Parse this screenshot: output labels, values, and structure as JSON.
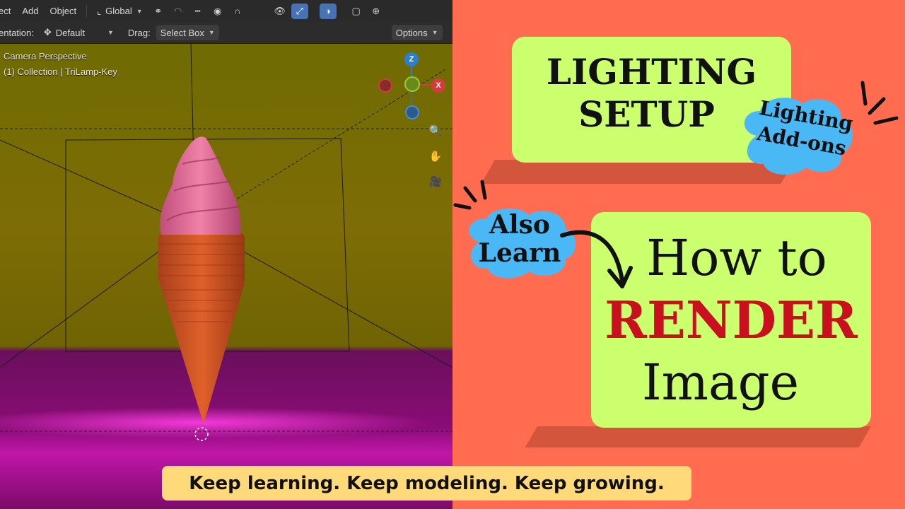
{
  "toolbar": {
    "menu_select_partial": "ect",
    "menu_add": "Add",
    "menu_object": "Object",
    "transform_orientation": "Global",
    "icons": [
      "transform-axes-icon",
      "link-icon",
      "magnet-icon",
      "snap-increment-icon",
      "proportional-edit-icon",
      "falloff-icon",
      "visibility-icon",
      "gizmo-icon",
      "overlay-icon",
      "xray-icon",
      "shading-wire-icon"
    ]
  },
  "header2": {
    "orientation_label": "entation:",
    "orientation_value": "Default",
    "drag_label": "Drag:",
    "drag_value": "Select Box",
    "options_label": "Options"
  },
  "viewport": {
    "view_name": "Camera Perspective",
    "collection_info": "(1) Collection | TriLamp-Key",
    "gizmo": {
      "z": "Z",
      "x": "X"
    }
  },
  "thumbnail": {
    "card1_line1": "LIGHTING",
    "card1_line2": "SETUP",
    "bubble1_line1": "Lighting",
    "bubble1_line2": "Add-ons",
    "bubble2_line1": "Also",
    "bubble2_line2": "Learn",
    "card2_line1": "How to",
    "card2_line2": "RENDER",
    "card2_line3": "Image",
    "footer": "Keep learning. Keep modeling. Keep growing."
  },
  "colors": {
    "background": "#ff6c4f",
    "card": "#cbff6e",
    "bubble": "#4ab8f5",
    "render_red": "#c8101e",
    "footer": "#ffd97a"
  }
}
